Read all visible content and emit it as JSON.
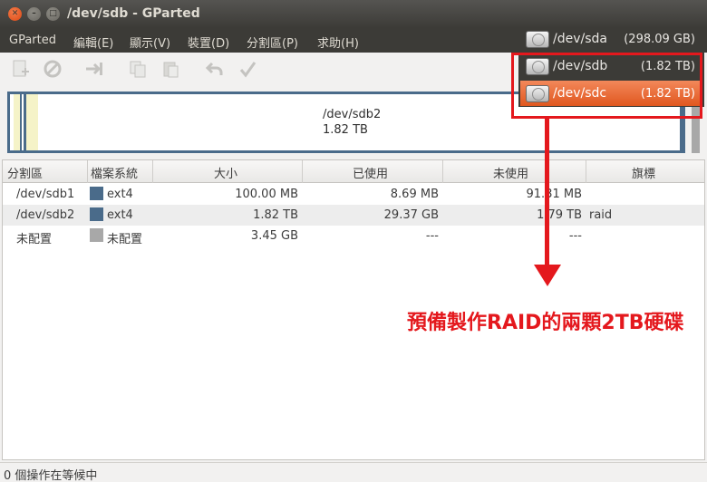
{
  "window": {
    "title": "/dev/sdb - GParted"
  },
  "menu": [
    "GParted",
    "編輯(E)",
    "顯示(V)",
    "裝置(D)",
    "分割區(P)",
    "求助(H)"
  ],
  "devices": [
    {
      "name": "/dev/sda",
      "size": "(298.09 GB)"
    },
    {
      "name": "/dev/sdb",
      "size": "(1.82 TB)"
    },
    {
      "name": "/dev/sdc",
      "size": "(1.82 TB)"
    }
  ],
  "selected_device": "/dev/sdc",
  "partition_bar": {
    "name": "/dev/sdb2",
    "size": "1.82 TB"
  },
  "table": {
    "headers": [
      "分割區",
      "檔案系統",
      "大小",
      "已使用",
      "未使用",
      "旗標"
    ],
    "rows": [
      {
        "partition": "/dev/sdb1",
        "fs": "ext4",
        "size": "100.00 MB",
        "used": "8.69 MB",
        "unused": "91.31 MB",
        "flags": ""
      },
      {
        "partition": "/dev/sdb2",
        "fs": "ext4",
        "size": "1.82 TB",
        "used": "29.37 GB",
        "unused": "1.79 TB",
        "flags": "raid"
      },
      {
        "partition": "未配置",
        "fs": "未配置",
        "size": "3.45 GB",
        "used": "---",
        "unused": "---",
        "flags": ""
      }
    ]
  },
  "annotation": "預備製作RAID的兩顆2TB硬碟",
  "status": "0 個操作在等候中",
  "colors": {
    "ext4": "#4a6b8a",
    "unallocated": "#a8a8a8",
    "highlight": "#e4181d",
    "selection": "#e0571f"
  }
}
